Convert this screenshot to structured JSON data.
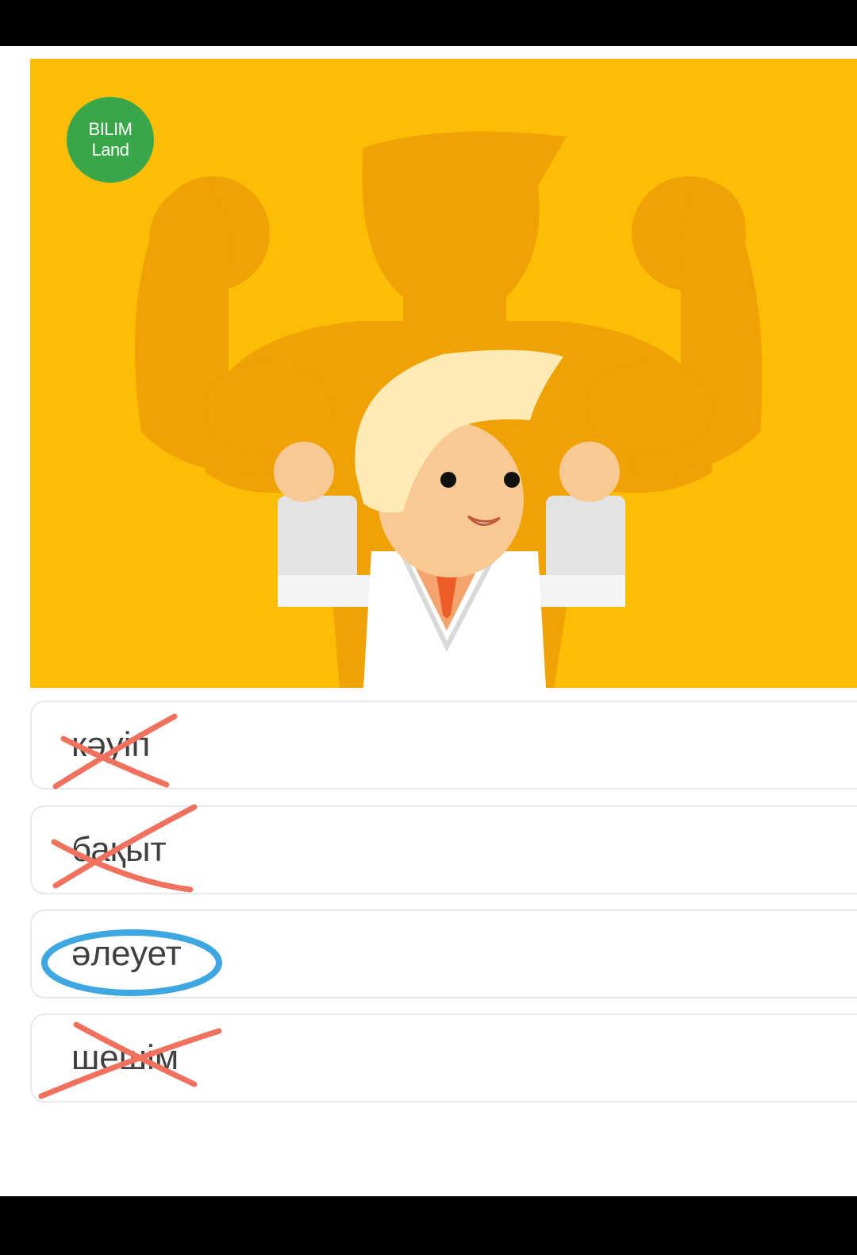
{
  "logo": {
    "line1": "BILIM",
    "line2": "Land"
  },
  "options": [
    {
      "label": "кәуіп",
      "mark": "crossed"
    },
    {
      "label": "бақыт",
      "mark": "crossed"
    },
    {
      "label": "әлеует",
      "mark": "circled"
    },
    {
      "label": "шешім",
      "mark": "crossed"
    }
  ],
  "colors": {
    "background_yellow": "#fbbd05",
    "shadow_orange": "#f0a104",
    "logo_green": "#3aa64a",
    "cross_red": "#f0715e",
    "circle_blue": "#3ea6e0"
  }
}
